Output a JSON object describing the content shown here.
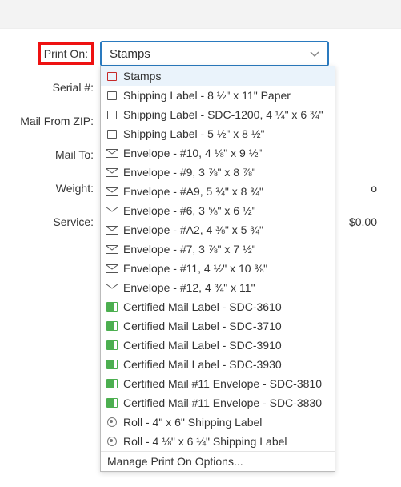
{
  "form": {
    "print_on_label": "Print On:",
    "serial_label": "Serial #:",
    "mail_from_zip_label": "Mail From ZIP:",
    "mail_to_label": "Mail To:",
    "weight_label": "Weight:",
    "service_label": "Service:",
    "weight_trailing": "o",
    "service_trailing": "$0.00"
  },
  "select": {
    "value": "Stamps"
  },
  "dropdown": {
    "items": [
      {
        "icon": "stamp",
        "label": "Stamps",
        "selected": true
      },
      {
        "icon": "sheet",
        "label": "Shipping Label - 8 ½\" x 11\" Paper"
      },
      {
        "icon": "sheet",
        "label": "Shipping Label - SDC-1200, 4 ¼\" x 6 ¾\""
      },
      {
        "icon": "sheet",
        "label": "Shipping Label - 5 ½\" x 8 ½\""
      },
      {
        "icon": "envelope",
        "label": "Envelope - #10, 4 ⅛\" x 9 ½\""
      },
      {
        "icon": "envelope",
        "label": "Envelope - #9, 3 ⅞\" x 8 ⅞\""
      },
      {
        "icon": "envelope",
        "label": "Envelope - #A9, 5 ¾\" x 8 ¾\""
      },
      {
        "icon": "envelope",
        "label": "Envelope - #6, 3 ⅝\" x 6 ½\""
      },
      {
        "icon": "envelope",
        "label": "Envelope - #A2, 4 ⅜\" x 5 ¾\""
      },
      {
        "icon": "envelope",
        "label": "Envelope - #7, 3 ⅞\" x 7 ½\""
      },
      {
        "icon": "envelope",
        "label": "Envelope - #11, 4 ½\" x 10 ⅜\""
      },
      {
        "icon": "envelope",
        "label": "Envelope - #12, 4 ¾\" x 11\""
      },
      {
        "icon": "cert",
        "label": "Certified Mail Label - SDC-3610"
      },
      {
        "icon": "cert",
        "label": "Certified Mail Label - SDC-3710"
      },
      {
        "icon": "cert",
        "label": "Certified Mail Label - SDC-3910"
      },
      {
        "icon": "cert",
        "label": "Certified Mail Label - SDC-3930"
      },
      {
        "icon": "cert",
        "label": "Certified Mail #11 Envelope - SDC-3810"
      },
      {
        "icon": "cert",
        "label": "Certified Mail #11 Envelope - SDC-3830"
      },
      {
        "icon": "roll",
        "label": "Roll - 4\" x 6\" Shipping Label"
      },
      {
        "icon": "roll",
        "label": "Roll - 4 ⅛\" x 6 ¼\" Shipping Label"
      }
    ],
    "manage_label": "Manage Print On Options..."
  }
}
